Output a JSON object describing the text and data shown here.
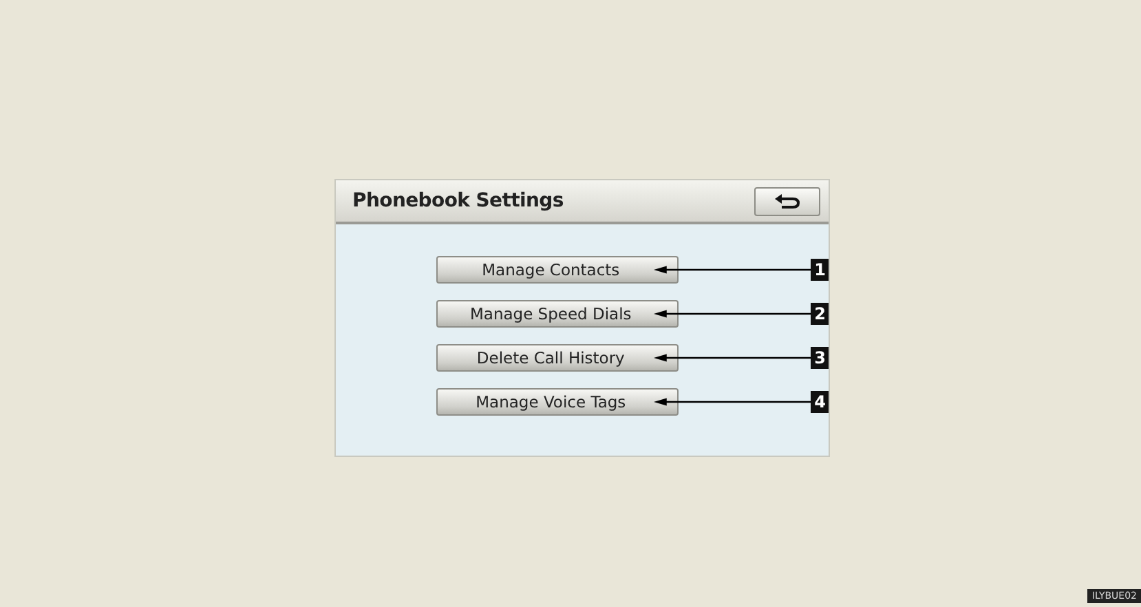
{
  "screen": {
    "title": "Phonebook Settings"
  },
  "menu": [
    {
      "label": "Manage Contacts",
      "callout": "1"
    },
    {
      "label": "Manage Speed Dials",
      "callout": "2"
    },
    {
      "label": "Delete Call History",
      "callout": "3"
    },
    {
      "label": "Manage Voice Tags",
      "callout": "4"
    }
  ],
  "figure_code": "ILYBUE02"
}
